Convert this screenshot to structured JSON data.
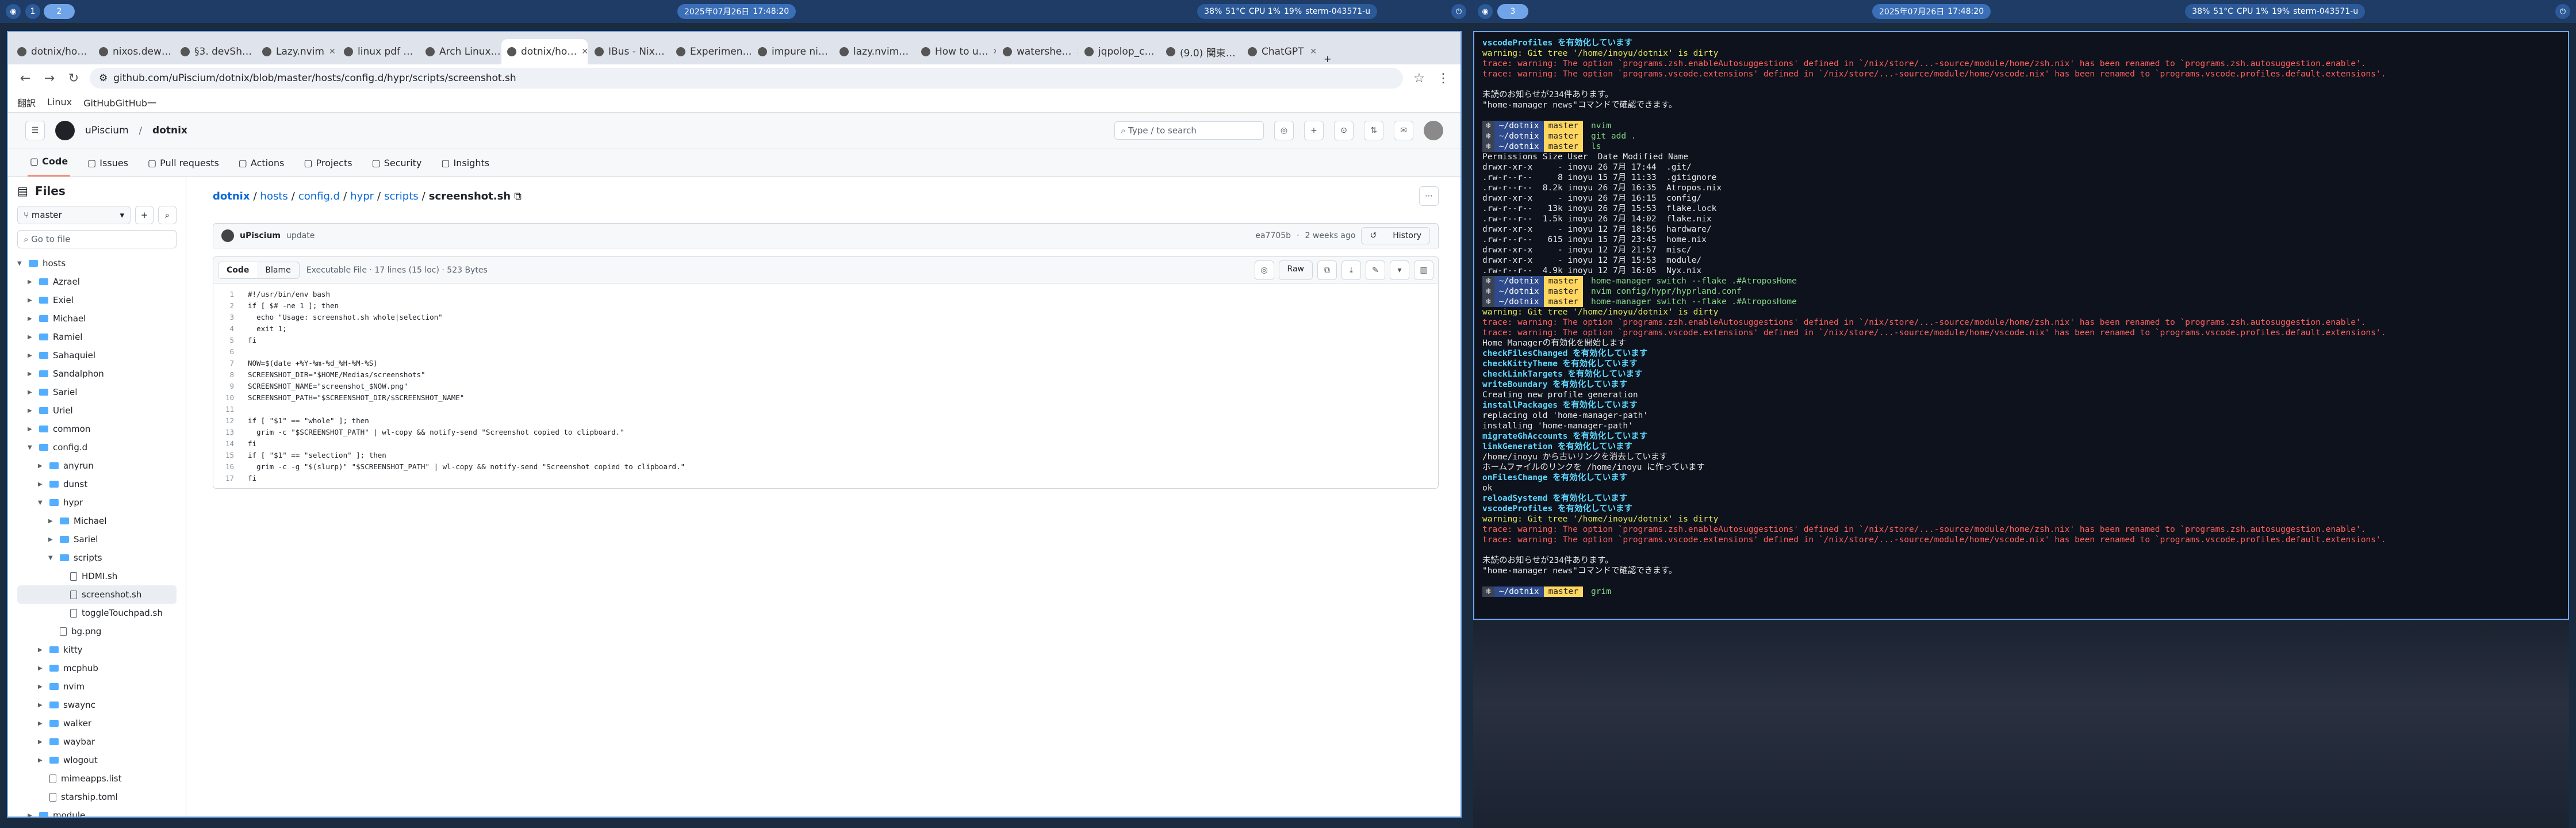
{
  "topbar_left": {
    "workspaces": [
      "1",
      "2"
    ],
    "status": {
      "battery": "38%",
      "temp": "51°C",
      "cpu": "CPU 1%",
      "ram": "19%",
      "host": "sterm-043571-u",
      "date": "2025年07月26日",
      "time": "17:48:20"
    }
  },
  "topbar_right": {
    "workspaces": [
      "3"
    ],
    "status": {
      "battery": "38%",
      "temp": "51°C",
      "cpu": "CPU 1%",
      "ram": "19%",
      "host": "sterm-043571-u",
      "date": "2025年07月26日",
      "time": "17:48:20"
    }
  },
  "browser": {
    "tabs": [
      "dotnix/ho…",
      "nixos.dew…",
      "§3. devSh…",
      "Lazy.nvim",
      "linux pdf …",
      "Arch Linux…",
      "dotnix/ho…",
      "IBus - Nix…",
      "Experimen…",
      "impure ni…",
      "lazy.nvim…",
      "How to u…",
      "watershe…",
      "jqpolop_c…",
      "(9.0) 関東…",
      "ChatGPT"
    ],
    "active_tab": 6,
    "url": "github.com/uPiscium/dotnix/blob/master/hosts/config.d/hypr/scripts/screenshot.sh",
    "bookmarks": [
      "翻訳",
      "Linux",
      "GitHubGitHub一"
    ],
    "owner": "uPiscium",
    "repo": "dotnix",
    "search_placeholder": "Type / to search",
    "nav": [
      "Code",
      "Issues",
      "Pull requests",
      "Actions",
      "Projects",
      "Security",
      "Insights"
    ],
    "sidebar": {
      "title": "Files",
      "branch": "master",
      "goto": "Go to file",
      "tree": [
        {
          "name": "hosts",
          "type": "folder",
          "depth": 0,
          "open": true
        },
        {
          "name": "Azrael",
          "type": "folder",
          "depth": 1
        },
        {
          "name": "Exiel",
          "type": "folder",
          "depth": 1
        },
        {
          "name": "Michael",
          "type": "folder",
          "depth": 1
        },
        {
          "name": "Ramiel",
          "type": "folder",
          "depth": 1
        },
        {
          "name": "Sahaquiel",
          "type": "folder",
          "depth": 1
        },
        {
          "name": "Sandalphon",
          "type": "folder",
          "depth": 1
        },
        {
          "name": "Sariel",
          "type": "folder",
          "depth": 1
        },
        {
          "name": "Uriel",
          "type": "folder",
          "depth": 1
        },
        {
          "name": "common",
          "type": "folder",
          "depth": 1
        },
        {
          "name": "config.d",
          "type": "folder",
          "depth": 1,
          "open": true
        },
        {
          "name": "anyrun",
          "type": "folder",
          "depth": 2
        },
        {
          "name": "dunst",
          "type": "folder",
          "depth": 2
        },
        {
          "name": "hypr",
          "type": "folder",
          "depth": 2,
          "open": true
        },
        {
          "name": "Michael",
          "type": "folder",
          "depth": 3
        },
        {
          "name": "Sariel",
          "type": "folder",
          "depth": 3
        },
        {
          "name": "scripts",
          "type": "folder",
          "depth": 3,
          "open": true
        },
        {
          "name": "HDMI.sh",
          "type": "file",
          "depth": 4
        },
        {
          "name": "screenshot.sh",
          "type": "file",
          "depth": 4,
          "selected": true
        },
        {
          "name": "toggleTouchpad.sh",
          "type": "file",
          "depth": 4
        },
        {
          "name": "bg.png",
          "type": "file",
          "depth": 3
        },
        {
          "name": "kitty",
          "type": "folder",
          "depth": 2
        },
        {
          "name": "mcphub",
          "type": "folder",
          "depth": 2
        },
        {
          "name": "nvim",
          "type": "folder",
          "depth": 2
        },
        {
          "name": "swaync",
          "type": "folder",
          "depth": 2
        },
        {
          "name": "walker",
          "type": "folder",
          "depth": 2
        },
        {
          "name": "waybar",
          "type": "folder",
          "depth": 2
        },
        {
          "name": "wlogout",
          "type": "folder",
          "depth": 2
        },
        {
          "name": "mimeapps.list",
          "type": "file",
          "depth": 2
        },
        {
          "name": "starship.toml",
          "type": "file",
          "depth": 2
        },
        {
          "name": "module",
          "type": "folder",
          "depth": 1
        }
      ]
    },
    "breadcrumb": [
      "dotnix",
      "hosts",
      "config.d",
      "hypr",
      "scripts"
    ],
    "filename": "screenshot.sh",
    "commit": {
      "author": "uPiscium",
      "message": "update",
      "hash": "ea7705b",
      "when": "2 weeks ago",
      "history": "History"
    },
    "code_tabs": [
      "Code",
      "Blame"
    ],
    "file_info": "Executable File · 17 lines (15 loc) · 523 Bytes",
    "raw": "Raw",
    "code": [
      "#!/usr/bin/env bash",
      "if [ $# -ne 1 ]; then",
      "  echo \"Usage: screenshot.sh whole|selection\"",
      "  exit 1;",
      "fi",
      "",
      "NOW=$(date +%Y-%m-%d_%H-%M-%S)",
      "SCREENSHOT_DIR=\"$HOME/Medias/screenshots\"",
      "SCREENSHOT_NAME=\"screenshot_$NOW.png\"",
      "SCREENSHOT_PATH=\"$SCREENSHOT_DIR/$SCREENSHOT_NAME\"",
      "",
      "if [ \"$1\" == \"whole\" ]; then",
      "  grim -c \"$SCREENSHOT_PATH\" | wl-copy && notify-send \"Screenshot copied to clipboard.\"",
      "fi",
      "if [ \"$1\" == \"selection\" ]; then",
      "  grim -c -g \"$(slurp)\" \"$SCREENSHOT_PATH\" | wl-copy && notify-send \"Screenshot copied to clipboard.\"",
      "fi"
    ]
  },
  "terminal": {
    "lines": [
      {
        "t": "g",
        "s": "vscodeProfiles を有効化しています"
      },
      {
        "t": "y",
        "s": "warning: Git tree '/home/inoyu/dotnix' is dirty"
      },
      {
        "t": "r",
        "s": "trace: warning: The option `programs.zsh.enableAutosuggestions' defined in `/nix/store/...-source/module/home/zsh.nix' has been renamed to `programs.zsh.autosuggestion.enable'."
      },
      {
        "t": "r",
        "s": "trace: warning: The option `programs.vscode.extensions' defined in `/nix/store/...-source/module/home/vscode.nix' has been renamed to `programs.vscode.profiles.default.extensions'."
      },
      {
        "t": "w",
        "s": ""
      },
      {
        "t": "w",
        "s": "未読のお知らせが234件あります。"
      },
      {
        "t": "w",
        "s": "\"home-manager news\"コマンドで確認できます。"
      },
      {
        "t": "w",
        "s": ""
      },
      {
        "t": "p",
        "s": "nvim"
      },
      {
        "t": "p",
        "s": "git add ."
      },
      {
        "t": "p",
        "s": "ls"
      },
      {
        "t": "w",
        "s": "Permissions Size User  Date Modified Name"
      },
      {
        "t": "w",
        "s": "drwxr-xr-x     - inoyu 26 7月 17:44  .git/"
      },
      {
        "t": "w",
        "s": ".rw-r--r--     8 inoyu 15 7月 11:33  .gitignore"
      },
      {
        "t": "w",
        "s": ".rw-r--r--  8.2k inoyu 26 7月 16:35  Atropos.nix"
      },
      {
        "t": "w",
        "s": "drwxr-xr-x     - inoyu 26 7月 16:15  config/"
      },
      {
        "t": "w",
        "s": ".rw-r--r--   13k inoyu 26 7月 15:53  flake.lock"
      },
      {
        "t": "w",
        "s": ".rw-r--r--  1.5k inoyu 26 7月 14:02  flake.nix"
      },
      {
        "t": "w",
        "s": "drwxr-xr-x     - inoyu 12 7月 18:56  hardware/"
      },
      {
        "t": "w",
        "s": ".rw-r--r--   615 inoyu 15 7月 23:45  home.nix"
      },
      {
        "t": "w",
        "s": "drwxr-xr-x     - inoyu 12 7月 21:57  misc/"
      },
      {
        "t": "w",
        "s": "drwxr-xr-x     - inoyu 12 7月 15:53  module/"
      },
      {
        "t": "w",
        "s": ".rw-r--r--  4.9k inoyu 12 7月 16:05  Nyx.nix"
      },
      {
        "t": "p",
        "s": "home-manager switch --flake .#AtroposHome"
      },
      {
        "t": "p",
        "s": "nvim config/hypr/hyprland.conf"
      },
      {
        "t": "p",
        "s": "home-manager switch --flake .#AtroposHome"
      },
      {
        "t": "y",
        "s": "warning: Git tree '/home/inoyu/dotnix' is dirty"
      },
      {
        "t": "r",
        "s": "trace: warning: The option `programs.zsh.enableAutosuggestions' defined in `/nix/store/...-source/module/home/zsh.nix' has been renamed to `programs.zsh.autosuggestion.enable'."
      },
      {
        "t": "r",
        "s": "trace: warning: The option `programs.vscode.extensions' defined in `/nix/store/...-source/module/home/vscode.nix' has been renamed to `programs.vscode.profiles.default.extensions'."
      },
      {
        "t": "w",
        "s": "Home Managerの有効化を開始します"
      },
      {
        "t": "g",
        "s": "checkFilesChanged を有効化しています"
      },
      {
        "t": "g",
        "s": "checkKittyTheme を有効化しています"
      },
      {
        "t": "g",
        "s": "checkLinkTargets を有効化しています"
      },
      {
        "t": "g",
        "s": "writeBoundary を有効化しています"
      },
      {
        "t": "w",
        "s": "Creating new profile generation"
      },
      {
        "t": "g",
        "s": "installPackages を有効化しています"
      },
      {
        "t": "w",
        "s": "replacing old 'home-manager-path'"
      },
      {
        "t": "w",
        "s": "installing 'home-manager-path'"
      },
      {
        "t": "g",
        "s": "migrateGhAccounts を有効化しています"
      },
      {
        "t": "g",
        "s": "linkGeneration を有効化しています"
      },
      {
        "t": "w",
        "s": "/home/inoyu から古いリンクを消去しています"
      },
      {
        "t": "w",
        "s": "ホームファイルのリンクを /home/inoyu に作っています"
      },
      {
        "t": "g",
        "s": "onFilesChange を有効化しています"
      },
      {
        "t": "w",
        "s": "ok"
      },
      {
        "t": "g",
        "s": "reloadSystemd を有効化しています"
      },
      {
        "t": "g",
        "s": "vscodeProfiles を有効化しています"
      },
      {
        "t": "y",
        "s": "warning: Git tree '/home/inoyu/dotnix' is dirty"
      },
      {
        "t": "r",
        "s": "trace: warning: The option `programs.zsh.enableAutosuggestions' defined in `/nix/store/...-source/module/home/zsh.nix' has been renamed to `programs.zsh.autosuggestion.enable'."
      },
      {
        "t": "r",
        "s": "trace: warning: The option `programs.vscode.extensions' defined in `/nix/store/...-source/module/home/vscode.nix' has been renamed to `programs.vscode.profiles.default.extensions'."
      },
      {
        "t": "w",
        "s": ""
      },
      {
        "t": "w",
        "s": "未読のお知らせが234件あります。"
      },
      {
        "t": "w",
        "s": "\"home-manager news\"コマンドで確認できます。"
      },
      {
        "t": "w",
        "s": ""
      },
      {
        "t": "p",
        "s": "grim"
      }
    ],
    "prompt_dir": "~/dotnix",
    "prompt_branch": "master"
  }
}
